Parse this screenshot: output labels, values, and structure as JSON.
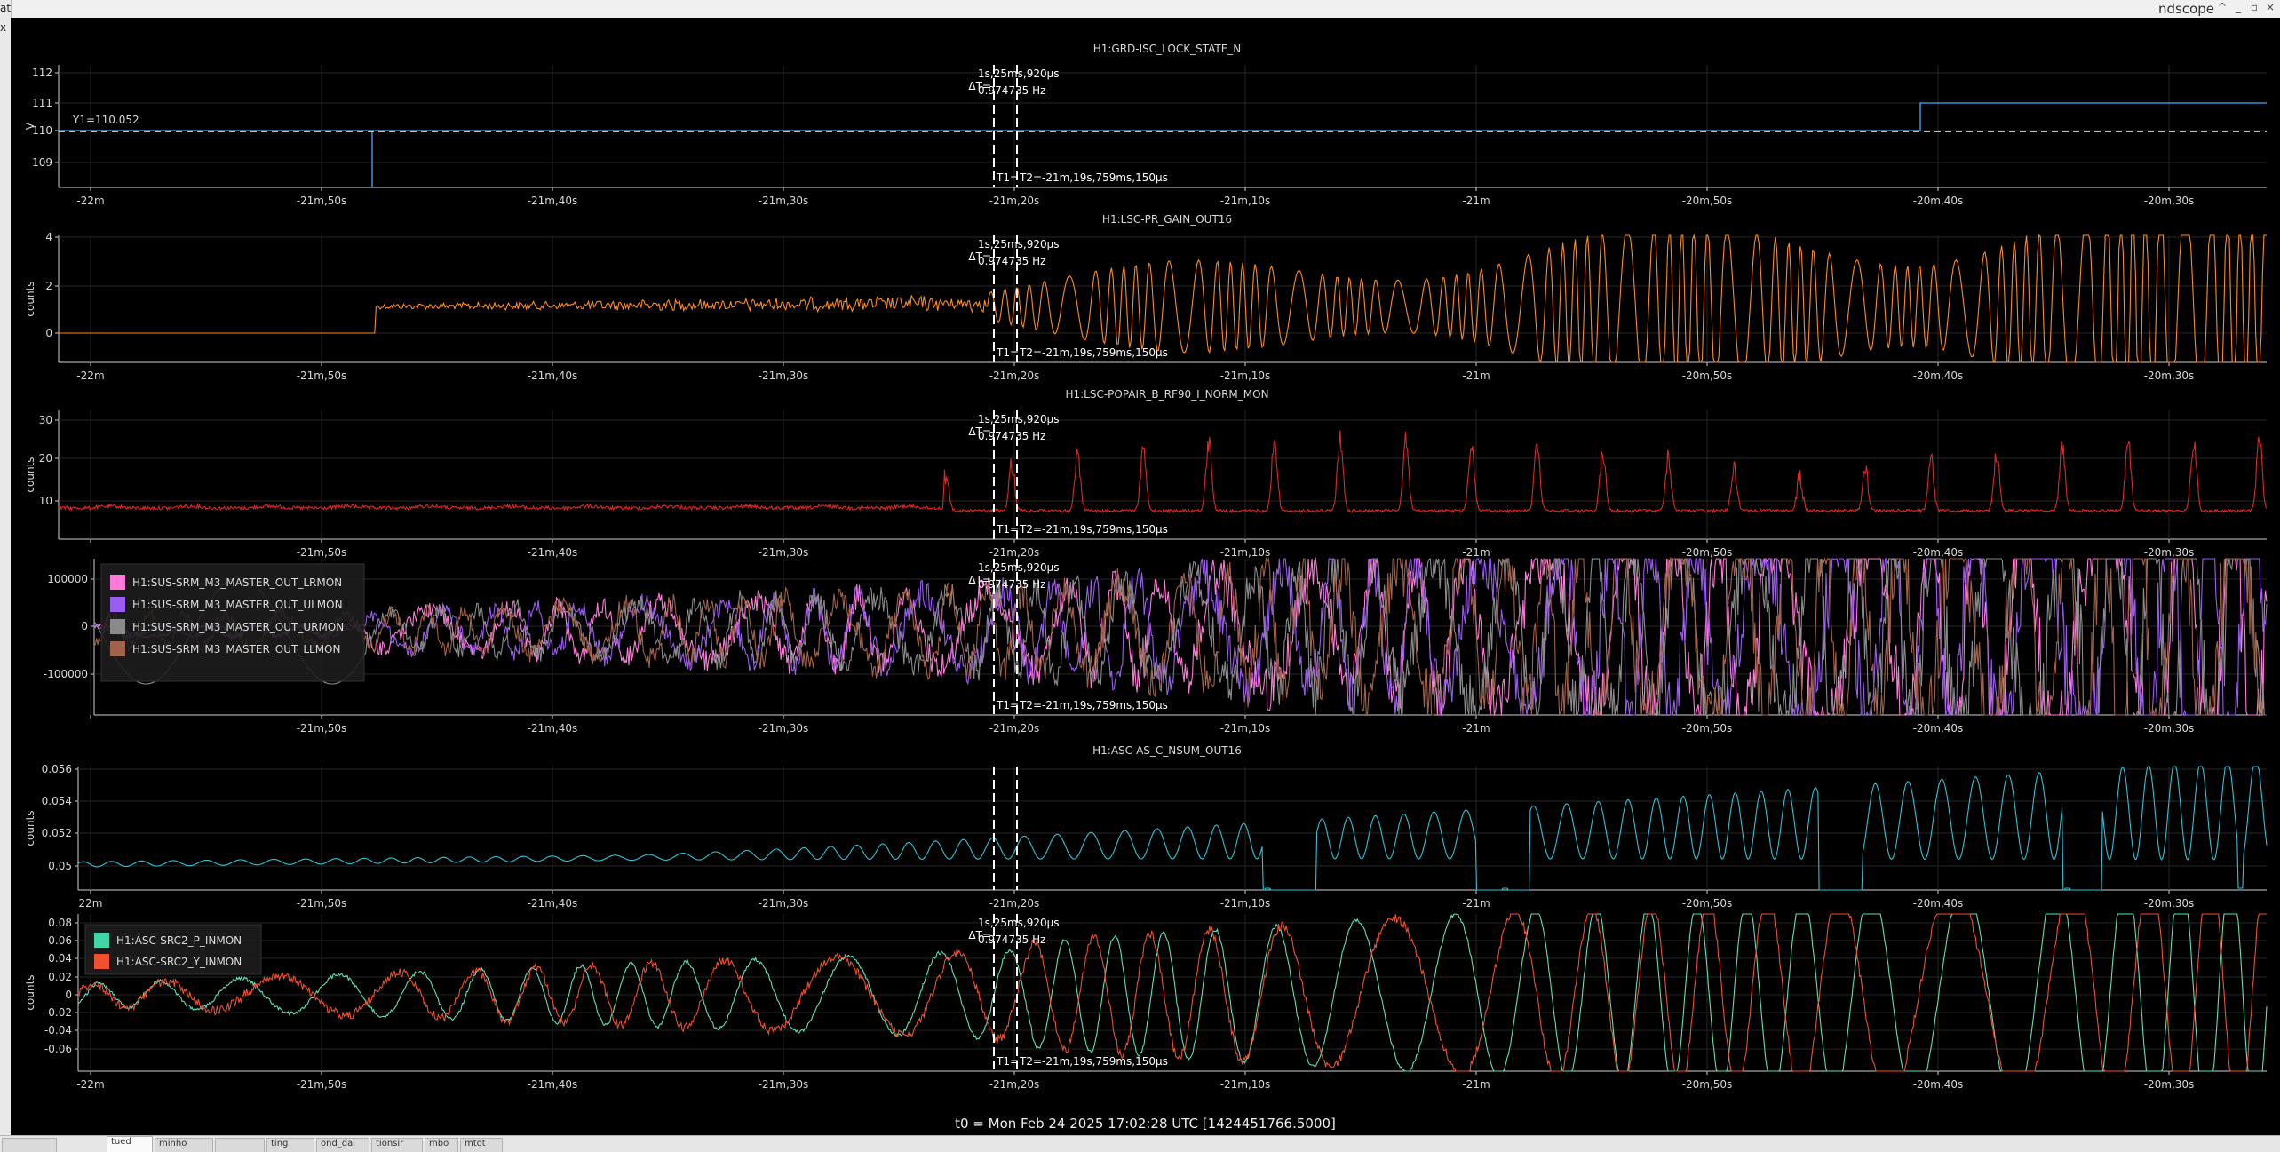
{
  "window": {
    "title": "ndscope",
    "controls": [
      "^",
      "_",
      "▫",
      "×"
    ]
  },
  "left_strip": {
    "fragments": [
      "at",
      "x"
    ]
  },
  "cursors": {
    "dt": "ΔT=",
    "dt_value": "1s,25ms,920μs",
    "freq": "0.974735 Hz",
    "t1": "T1=",
    "t2": "T2=-21m,19s,759ms,150μs"
  },
  "time_axis_labels": [
    "-22m",
    "-21m,50s",
    "-21m,40s",
    "-21m,30s",
    "-21m,20s",
    "-21m,10s",
    "-21m",
    "-20m,50s",
    "-20m,40s",
    "-20m,30s"
  ],
  "panels": [
    {
      "title": "H1:GRD-ISC_LOCK_STATE_N",
      "ylabel": "V",
      "ytick_labels": [
        "112",
        "111",
        "110",
        "109"
      ],
      "y_cursor_label": "Y1=110.052",
      "first_tick_label": "-22m",
      "legend": [],
      "colors": [
        "#4da6ff"
      ]
    },
    {
      "title": "H1:LSC-PR_GAIN_OUT16",
      "ylabel": "counts",
      "ytick_labels": [
        "4",
        "2",
        "0"
      ],
      "first_tick_label": "-22m",
      "legend": [],
      "colors": [
        "#ff8c1a"
      ]
    },
    {
      "title": "H1:LSC-POPAIR_B_RF90_I_NORM_MON",
      "ylabel": "counts",
      "ytick_labels": [
        "30",
        "20",
        "10"
      ],
      "first_tick_label": "",
      "legend": [],
      "colors": [
        "#e02626"
      ]
    },
    {
      "title": "",
      "ylabel": "",
      "ytick_labels": [
        "100000",
        "0",
        "-100000"
      ],
      "first_tick_label": "",
      "legend": [
        {
          "label": "H1:SUS-SRM_M3_MASTER_OUT_LRMON",
          "color": "#ff7ad9"
        },
        {
          "label": "H1:SUS-SRM_M3_MASTER_OUT_ULMON",
          "color": "#9b5cf0"
        },
        {
          "label": "H1:SUS-SRM_M3_MASTER_OUT_URMON",
          "color": "#8a8a8a"
        },
        {
          "label": "H1:SUS-SRM_M3_MASTER_OUT_LLMON",
          "color": "#a0624a"
        }
      ],
      "colors": [
        "#ff7ad9",
        "#9b5cf0",
        "#8a8a8a",
        "#a0624a"
      ]
    },
    {
      "title": "H1:ASC-AS_C_NSUM_OUT16",
      "ylabel": "counts",
      "ytick_labels": [
        "0.056",
        "0.054",
        "0.052",
        "0.05"
      ],
      "first_tick_label": "22m",
      "legend": [],
      "colors": [
        "#2bc4d9"
      ]
    },
    {
      "title": "",
      "ylabel": "counts",
      "ytick_labels": [
        "0.08",
        "0.06",
        "0.04",
        "0.02",
        "0",
        "-0.02",
        "-0.04",
        "-0.06"
      ],
      "first_tick_label": "-22m",
      "legend": [
        {
          "label": "H1:ASC-SRC2_P_INMON",
          "color": "#3fd6a8"
        },
        {
          "label": "H1:ASC-SRC2_Y_INMON",
          "color": "#f0502d"
        }
      ],
      "colors": [
        "#5fe0b5",
        "#f0502d"
      ]
    }
  ],
  "t0_label": "t0 = Mon Feb 24 2025 17:02:28 UTC [1424451766.5000]",
  "tabs": [
    "",
    "tued",
    "minho",
    "",
    "ting",
    "ond_dai",
    "tionsir",
    "mbo",
    "mtot"
  ]
}
